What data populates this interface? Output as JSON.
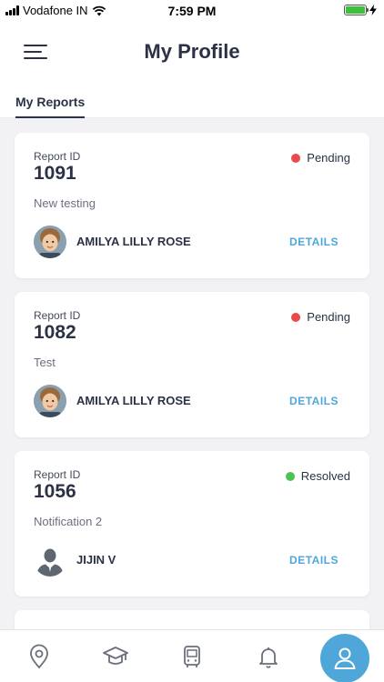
{
  "status_bar": {
    "carrier": "Vodafone IN",
    "time": "7:59 PM",
    "battery_level": 1.0
  },
  "header": {
    "title": "My Profile"
  },
  "tabs": [
    {
      "label": "My Reports",
      "active": true
    }
  ],
  "reports": [
    {
      "id_label": "Report ID",
      "id": "1091",
      "description": "New testing",
      "status": "Pending",
      "status_color": "#e94b4b",
      "reporter": "AMILYA LILLY ROSE",
      "avatar": "child-photo",
      "details_label": "DETAILS"
    },
    {
      "id_label": "Report ID",
      "id": "1082",
      "description": "Test",
      "status": "Pending",
      "status_color": "#e94b4b",
      "reporter": "AMILYA LILLY ROSE",
      "avatar": "child-photo",
      "details_label": "DETAILS"
    },
    {
      "id_label": "Report ID",
      "id": "1056",
      "description": "Notification 2",
      "status": "Resolved",
      "status_color": "#4cc452",
      "reporter": "JIJIN V",
      "avatar": "default-user",
      "details_label": "DETAILS"
    }
  ],
  "bottom_nav": [
    {
      "icon": "location-pin-icon",
      "active": false
    },
    {
      "icon": "graduation-cap-icon",
      "active": false
    },
    {
      "icon": "bus-icon",
      "active": false
    },
    {
      "icon": "bell-icon",
      "active": false
    },
    {
      "icon": "user-icon",
      "active": true
    }
  ],
  "colors": {
    "accent": "#4ea7d8",
    "primary_text": "#2b3246",
    "pending": "#e94b4b",
    "resolved": "#4cc452"
  }
}
